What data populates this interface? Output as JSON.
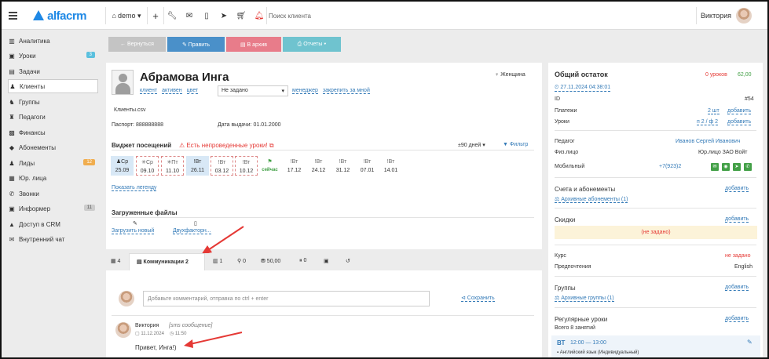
{
  "topbar": {
    "logo_text": "alfacrm",
    "branch": "demo ▾",
    "search_placeholder": "Поиск клиента",
    "user_name": "Виктория"
  },
  "sidebar": {
    "items": [
      {
        "label": "Аналитика",
        "icon": "chart-icon"
      },
      {
        "label": "Уроки",
        "icon": "calendar-icon",
        "badge": "3"
      },
      {
        "label": "Задачи",
        "icon": "tasks-icon"
      },
      {
        "label": "Клиенты",
        "icon": "user-icon"
      },
      {
        "label": "Группы",
        "icon": "group-icon"
      },
      {
        "label": "Педагоги",
        "icon": "teacher-icon"
      },
      {
        "label": "Финансы",
        "icon": "money-icon"
      },
      {
        "label": "Абонементы",
        "icon": "tag-icon"
      },
      {
        "label": "Лиды",
        "icon": "leads-icon",
        "badge": "12"
      },
      {
        "label": "Юр. лица",
        "icon": "building-icon"
      },
      {
        "label": "Звонки",
        "icon": "phone-icon"
      },
      {
        "label": "Информер",
        "icon": "inbox-icon",
        "badge": "11"
      },
      {
        "label": "Доступ в CRM",
        "icon": "lock-icon"
      },
      {
        "label": "Внутренний чат",
        "icon": "chat-icon"
      }
    ]
  },
  "actions": {
    "back": "← Вернуться",
    "edit": "✎ Править",
    "archive": "▤ В архив",
    "reports": "⎙ Отчеты ▾"
  },
  "client": {
    "name": "Абрамова Инга",
    "gender": "♀ Женщина",
    "status_links": [
      "клиент",
      "активен",
      "цвет"
    ],
    "manager_select": "Не задано",
    "manager_label": "менеджер",
    "assign_label": "закрепить за мной",
    "file": "Клиенты.csv",
    "passport": "Паспорт: 888888888",
    "issue_date": "Дата выдачи: 01.01.2000"
  },
  "attendance": {
    "title": "Виджет посещений",
    "warning": "⚠ Есть непроведенные уроки! ⧉",
    "period": "±90 дней ▾",
    "filter": "▼ Фильтр",
    "show_legend": "Показать легенду",
    "days": [
      {
        "top": "♟Ср",
        "date": "25.09",
        "style": "paid"
      },
      {
        "top": "✳Ср",
        "date": "09.10",
        "style": "box"
      },
      {
        "top": "✳Пт",
        "date": "11.10",
        "style": "box"
      },
      {
        "top": "!Вт",
        "date": "26.11",
        "style": "paid"
      },
      {
        "top": "!Вт",
        "date": "03.12",
        "style": "box"
      },
      {
        "top": "!Вт",
        "date": "10.12",
        "style": "box"
      },
      {
        "top": "⚑",
        "date": "сейчас",
        "style": "now"
      },
      {
        "top": "!Вт",
        "date": "17.12",
        "style": "plain"
      },
      {
        "top": "!Вт",
        "date": "24.12",
        "style": "plain"
      },
      {
        "top": "!Вт",
        "date": "31.12",
        "style": "plain"
      },
      {
        "top": "!Вт",
        "date": "07.01",
        "style": "plain"
      },
      {
        "top": "!Вт",
        "date": "14.01",
        "style": "plain"
      }
    ]
  },
  "files": {
    "title": "Загруженные файлы",
    "upload": "Загрузить новый",
    "twofactor": "Двухфакторн..."
  },
  "tabs": [
    {
      "label": "▦ 4"
    },
    {
      "label": "▤ Коммуникации 2"
    },
    {
      "label": "▥ 1"
    },
    {
      "label": "⚲ 0"
    },
    {
      "label": "⛃ 50,00"
    },
    {
      "label": "⏸ 0"
    },
    {
      "label": "▣"
    },
    {
      "label": "↺"
    }
  ],
  "comment": {
    "placeholder": "Добавьте комментарий, отправка по ctrl + enter",
    "save": "⊲ Сохранить",
    "author": "Виктория",
    "type": "[sms сообщение]",
    "date": "▢ 11.12.2024",
    "time": "◷ 11:50",
    "text": "Привет, Инга!)"
  },
  "right": {
    "balance_title": "Общий остаток",
    "lessons_left": "0 уроков",
    "amount": "62,00",
    "created": "⏲ 27.11.2024 04:38:01",
    "id_label": "ID",
    "id_value": "#54",
    "payments_label": "Платежи",
    "payments_value": "2 шт",
    "lessons_label": "Уроки",
    "lessons_value": "п 2 / ф 2",
    "add": "добавить",
    "teacher_label": "Педагог",
    "teacher_value": "Иванов Сергей Иванович",
    "entity_label": "Физ.лицо",
    "entity_value": "Юр.лицо ЗАО Войт",
    "mobile_label": "Мобильный",
    "mobile_value": "+7(923)2",
    "accounts_title": "Счета и абонементы",
    "archived_subs": "⚖ Архивные абонементы (1)",
    "discounts_title": "Скидки",
    "not_set": "(не задано)",
    "course_label": "Курс",
    "course_value": "не задано",
    "pref_label": "Предпочтения",
    "pref_value": "English",
    "groups_title": "Группы",
    "archived_groups": "⚖ Архивные группы (1)",
    "regular_title": "Регулярные уроки",
    "regular_total": "Всего 8 занятий",
    "regular_day": "ВТ",
    "regular_time": "12:00 — 13:00",
    "regular_subject": "▪ Английский язык (Индивидуальный)"
  }
}
